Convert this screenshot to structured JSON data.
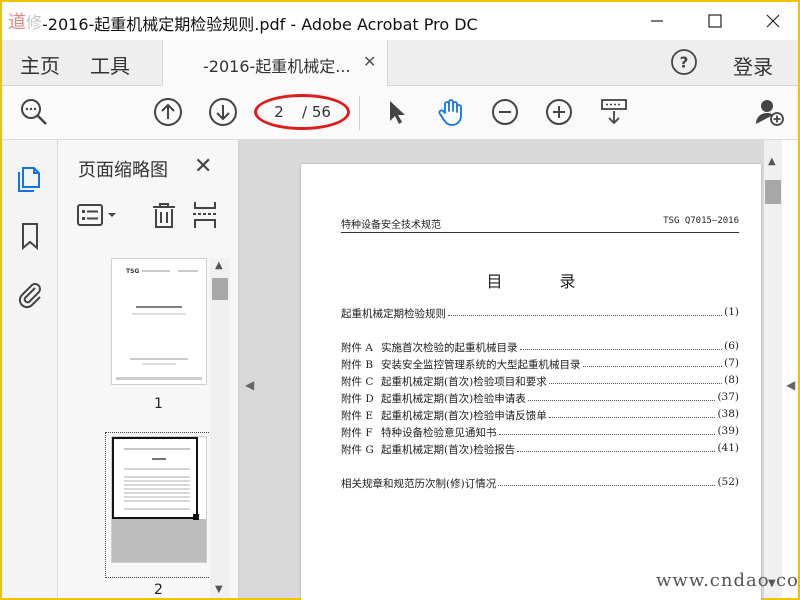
{
  "window": {
    "title": "-2016-起重机械定期检验规则.pdf - Adobe Acrobat Pro DC",
    "frame_color": "#f2c100"
  },
  "tabs": {
    "home": "主页",
    "tools": "工具",
    "doc_tab": "-2016-起重机械定...",
    "login": "登录"
  },
  "toolbar": {
    "current_page": "2",
    "total_pages": "/ 56",
    "highlight_color": "#e01b1b",
    "accent_color": "#1473e6"
  },
  "thumbnails": {
    "panel_title": "页面缩略图",
    "pages": [
      {
        "num": "1"
      },
      {
        "num": "2"
      }
    ]
  },
  "document": {
    "header_left": "特种设备安全技术规范",
    "header_right": "TSG Q7015—2016",
    "toc_title": "目 录",
    "entries": [
      {
        "prefix": "",
        "text": "起重机械定期检验规则",
        "page": "(1)"
      },
      {
        "prefix": "附件 A",
        "text": "实施首次检验的起重机械目录",
        "page": "(6)"
      },
      {
        "prefix": "附件 B",
        "text": "安装安全监控管理系统的大型起重机械目录",
        "page": "(7)"
      },
      {
        "prefix": "附件 C",
        "text": "起重机械定期(首次)检验项目和要求",
        "page": "(8)"
      },
      {
        "prefix": "附件 D",
        "text": "起重机械定期(首次)检验申请表",
        "page": "(37)"
      },
      {
        "prefix": "附件 E",
        "text": "起重机械定期(首次)检验申请反馈单",
        "page": "(38)"
      },
      {
        "prefix": "附件 F",
        "text": "特种设备检验意见通知书",
        "page": "(39)"
      },
      {
        "prefix": "附件 G",
        "text": "起重机械定期(首次)检验报告",
        "page": "(41)"
      },
      {
        "prefix": "",
        "text": "相关规章和规范历次制(修)订情况",
        "page": "(52)"
      }
    ]
  },
  "watermark": "www.cndao.com"
}
